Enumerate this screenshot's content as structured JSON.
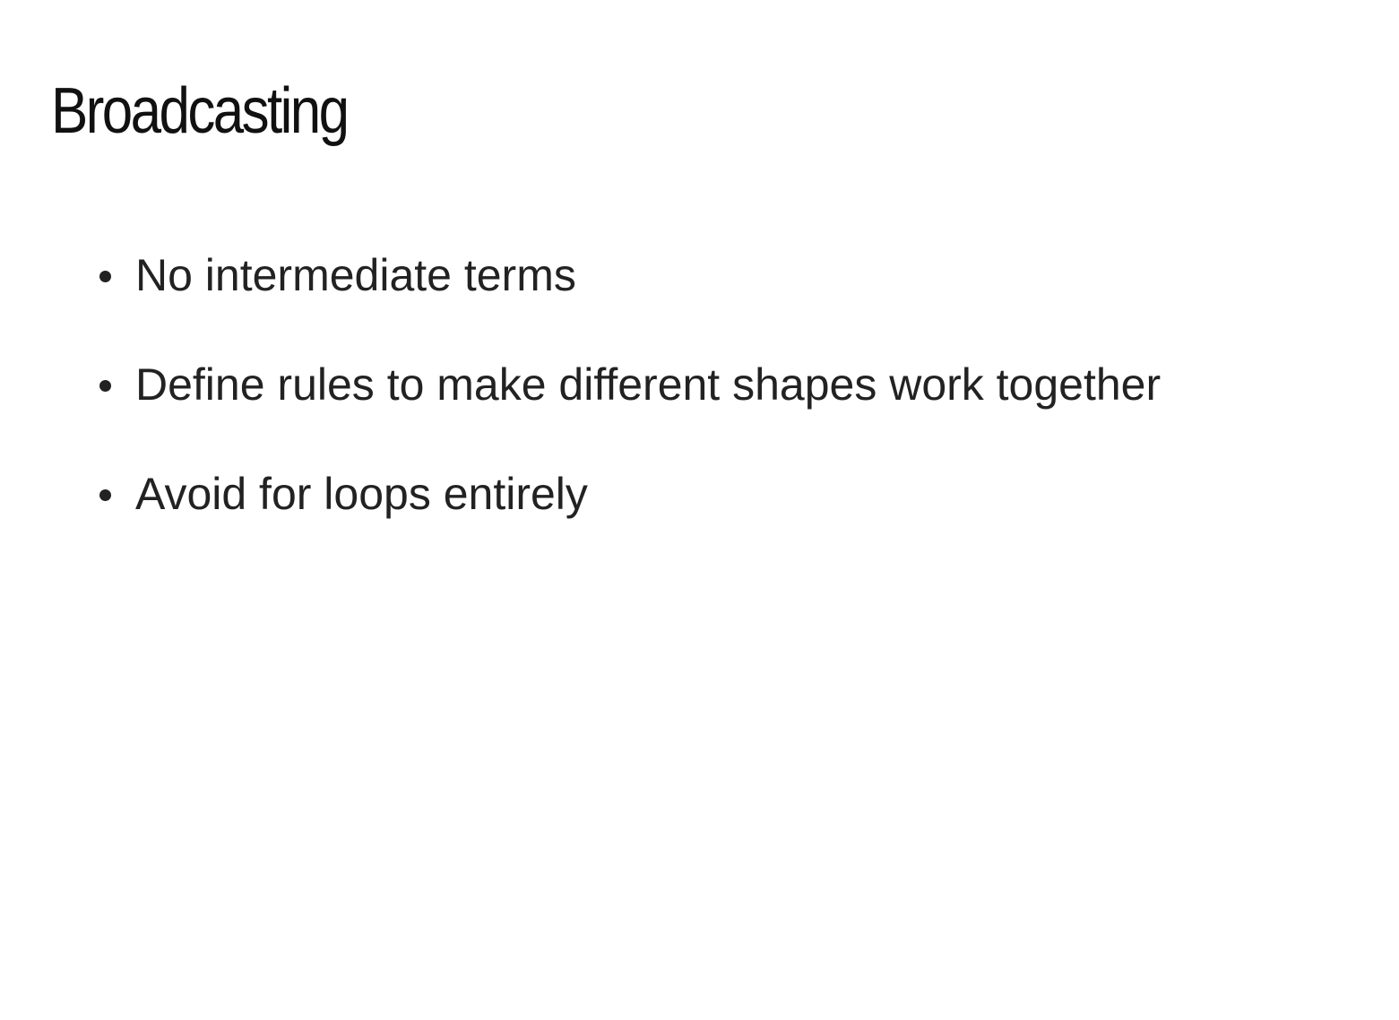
{
  "slide": {
    "title": "Broadcasting",
    "bullets": [
      {
        "text": "No intermediate terms"
      },
      {
        "text": "Define rules to make different shapes work together"
      },
      {
        "text": "Avoid for loops entirely"
      }
    ]
  },
  "colors": {
    "background": "#ffffff",
    "title_text": "#111111",
    "body_text": "#222222"
  },
  "icons": {
    "bullet": "bullet-dot-icon"
  }
}
